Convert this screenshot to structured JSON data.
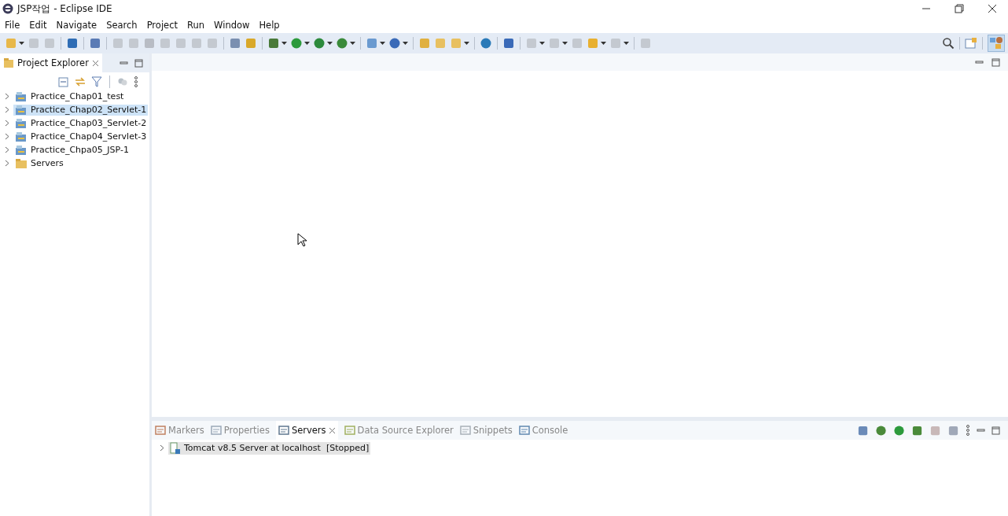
{
  "window": {
    "title": "JSP작업 - Eclipse IDE"
  },
  "menu": [
    "File",
    "Edit",
    "Navigate",
    "Search",
    "Project",
    "Run",
    "Window",
    "Help"
  ],
  "left_panel": {
    "tabs": [
      {
        "label": "Project Explorer",
        "selected": true
      }
    ],
    "tree": [
      {
        "label": "Practice_Chap01_test",
        "kind": "project",
        "selected": false
      },
      {
        "label": "Practice_Chap02_Servlet-1",
        "kind": "project",
        "selected": true
      },
      {
        "label": "Practice_Chap03_Servlet-2",
        "kind": "project",
        "selected": false
      },
      {
        "label": "Practice_Chap04_Servlet-3",
        "kind": "project",
        "selected": false
      },
      {
        "label": "Practice_Chpa05_JSP-1",
        "kind": "project",
        "selected": false
      },
      {
        "label": "Servers",
        "kind": "folder",
        "selected": false
      }
    ]
  },
  "bottom_panel": {
    "tabs": [
      {
        "label": "Markers",
        "selected": false
      },
      {
        "label": "Properties",
        "selected": false
      },
      {
        "label": "Servers",
        "selected": true
      },
      {
        "label": "Data Source Explorer",
        "selected": false
      },
      {
        "label": "Snippets",
        "selected": false
      },
      {
        "label": "Console",
        "selected": false
      }
    ],
    "servers": [
      {
        "label": "Tomcat v8.5 Server at localhost  [Stopped]",
        "selected": true
      }
    ]
  }
}
